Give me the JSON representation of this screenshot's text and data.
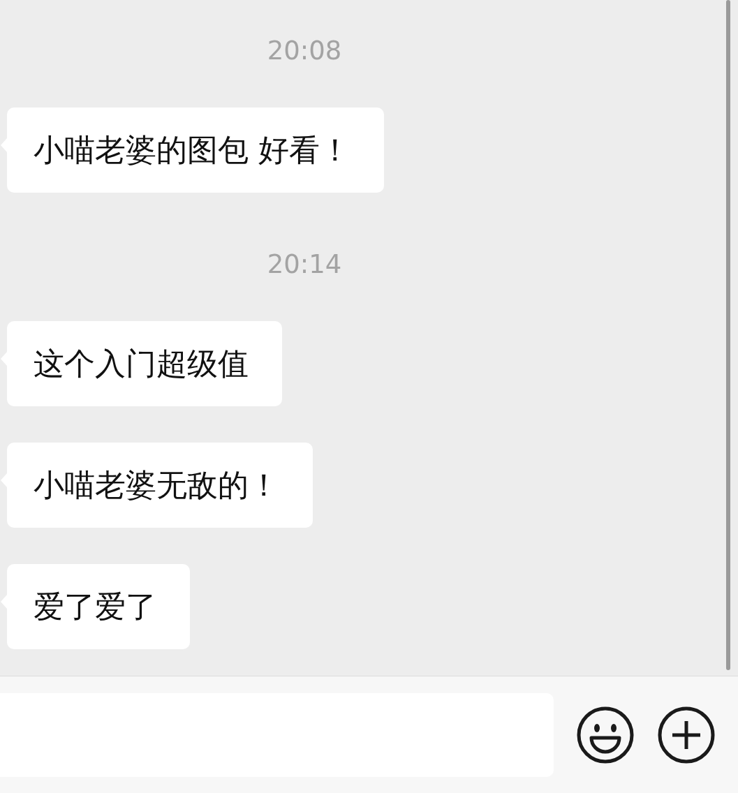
{
  "messages": [
    {
      "kind": "time",
      "text": "20:08"
    },
    {
      "kind": "bubble",
      "text": "小喵老婆的图包 好看！"
    },
    {
      "kind": "time",
      "text": "20:14"
    },
    {
      "kind": "bubble",
      "text": "这个入门超级值"
    },
    {
      "kind": "bubble",
      "text": "小喵老婆无敌的！"
    },
    {
      "kind": "bubble",
      "text": "爱了爱了"
    }
  ]
}
